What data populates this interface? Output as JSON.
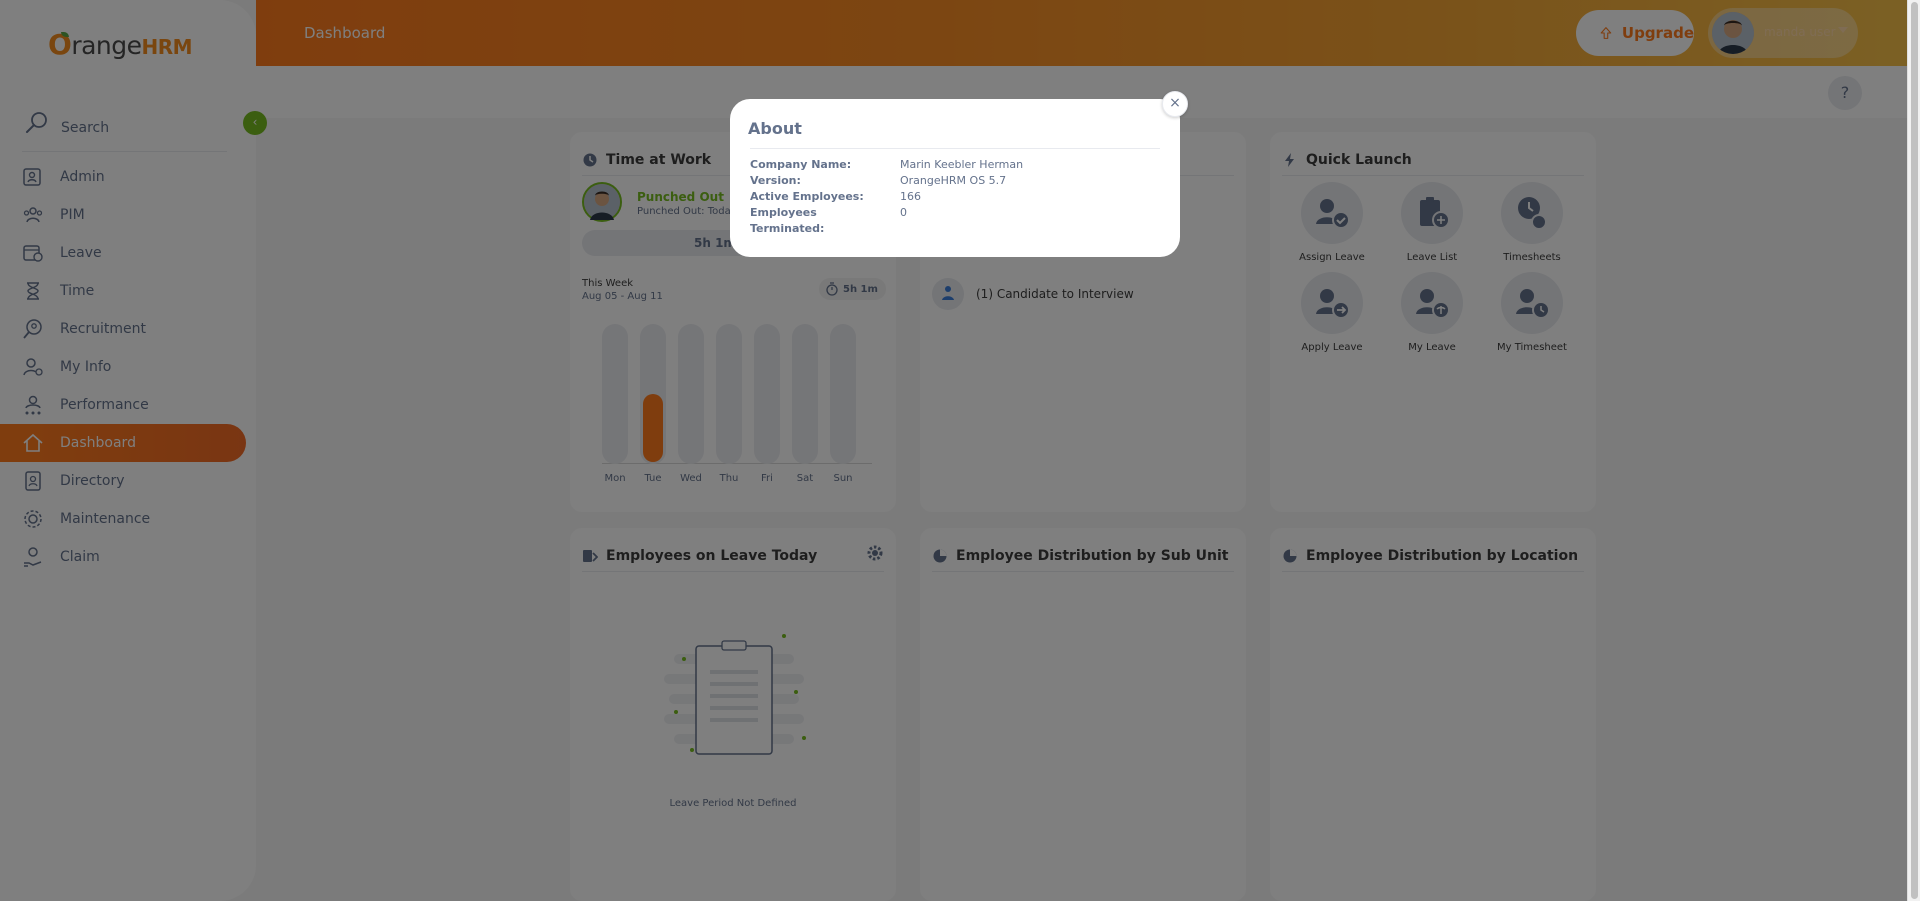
{
  "brand": {
    "prefix": "range",
    "hrm": "HRM"
  },
  "sidebar": {
    "search_label": "Search",
    "collapse_symbol": "‹",
    "items": [
      {
        "label": "Admin",
        "icon": "admin-icon"
      },
      {
        "label": "PIM",
        "icon": "pim-icon"
      },
      {
        "label": "Leave",
        "icon": "leave-icon"
      },
      {
        "label": "Time",
        "icon": "time-icon"
      },
      {
        "label": "Recruitment",
        "icon": "recruitment-icon"
      },
      {
        "label": "My Info",
        "icon": "my-info-icon"
      },
      {
        "label": "Performance",
        "icon": "performance-icon"
      },
      {
        "label": "Dashboard",
        "icon": "dashboard-icon",
        "active": true
      },
      {
        "label": "Directory",
        "icon": "directory-icon"
      },
      {
        "label": "Maintenance",
        "icon": "maintenance-icon"
      },
      {
        "label": "Claim",
        "icon": "claim-icon"
      }
    ]
  },
  "topbar": {
    "title": "Dashboard",
    "upgrade_label": "Upgrade",
    "user_name": "manda user"
  },
  "help_symbol": "?",
  "time_at_work": {
    "title": "Time at Work",
    "status": "Punched Out",
    "punched_out_text": "Punched Out: Today",
    "today_total": "5h 1m",
    "week_label": "This Week",
    "week_range": "Aug 05 - Aug 11",
    "week_total": "5h 1m",
    "days": [
      "Mon",
      "Tue",
      "Wed",
      "Thu",
      "Fri",
      "Sat",
      "Sun"
    ],
    "hours": [
      0,
      5.02,
      0,
      0,
      0,
      0,
      0
    ],
    "bar_label": "5.02",
    "max_hours": 6
  },
  "my_actions": {
    "candidate_text": "(1) Candidate to Interview"
  },
  "quick_launch": {
    "title": "Quick Launch",
    "items": [
      {
        "label": "Assign Leave",
        "icon": "assign-leave-icon"
      },
      {
        "label": "Leave List",
        "icon": "leave-list-icon"
      },
      {
        "label": "Timesheets",
        "icon": "timesheets-icon"
      },
      {
        "label": "Apply Leave",
        "icon": "apply-leave-icon"
      },
      {
        "label": "My Leave",
        "icon": "my-leave-icon"
      },
      {
        "label": "My Timesheet",
        "icon": "my-timesheet-icon"
      }
    ]
  },
  "leave_today": {
    "title": "Employees on Leave Today",
    "empty_text": "Leave Period Not Defined"
  },
  "dist_sub_unit": {
    "title": "Employee Distribution by Sub Unit"
  },
  "dist_location": {
    "title": "Employee Distribution by Location"
  },
  "about": {
    "title": "About",
    "close_symbol": "×",
    "rows": [
      {
        "key": "Company Name:",
        "value": "Marin Keebler Herman"
      },
      {
        "key": "Version:",
        "value": "OrangeHRM OS 5.7"
      },
      {
        "key": "Active Employees:",
        "value": "166"
      },
      {
        "key": "Employees Terminated:",
        "value": "0"
      }
    ]
  },
  "colors": {
    "accent": "#ff7b1d",
    "green": "#76bc21",
    "text": "#64728c"
  }
}
